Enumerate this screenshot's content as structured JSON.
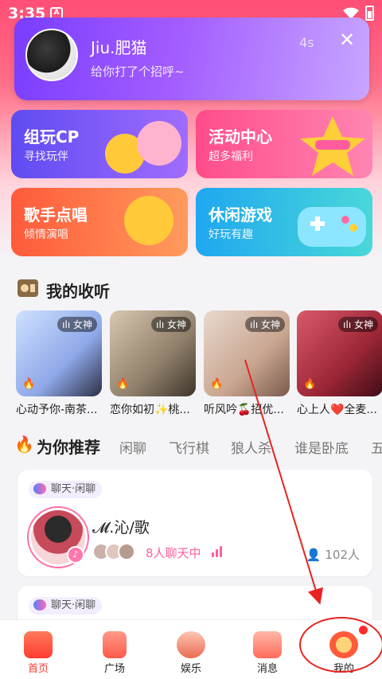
{
  "status_bar": {
    "time": "3:35",
    "app_icon": "A"
  },
  "notification": {
    "sender": "Jiu.肥猫",
    "message": "给你打了个招呼~",
    "time": "4s",
    "close_icon": "close-icon"
  },
  "tiles": [
    {
      "title": "组玩CP",
      "subtitle": "寻找玩伴"
    },
    {
      "title": "活动中心",
      "subtitle": "超多福利"
    },
    {
      "title": "歌手点唱",
      "subtitle": "倾情演唱"
    },
    {
      "title": "休闲游戏",
      "subtitle": "好玩有趣"
    }
  ],
  "listening": {
    "title": "我的收听",
    "items": [
      {
        "badge": "女神",
        "title": "心动予你-南茶..."
      },
      {
        "badge": "女神",
        "title": "恋你如初✨桃..."
      },
      {
        "badge": "女神",
        "title": "听风吟🍒招优..."
      },
      {
        "badge": "女神",
        "title": "心上人❤️全麦..."
      }
    ]
  },
  "recommend": {
    "title": "为你推荐",
    "tabs": [
      "闲聊",
      "飞行棋",
      "狼人杀",
      "谁是卧底",
      "五"
    ]
  },
  "rooms": [
    {
      "tag": "聊天·闲聊",
      "title": "𝓜.沁/歌",
      "chatting": "8人聊天中",
      "count": "102人"
    },
    {
      "tag": "聊天·闲聊"
    }
  ],
  "bottom_nav": [
    {
      "label": "首页",
      "active": true
    },
    {
      "label": "广场"
    },
    {
      "label": "娱乐"
    },
    {
      "label": "消息"
    },
    {
      "label": "我的"
    }
  ],
  "nav_labels": {
    "home": "首页",
    "square": "广场",
    "fun": "娱乐",
    "messages": "消息",
    "me": "我的"
  },
  "colors": {
    "accent": "#ff4f77",
    "nav_active": "#ff3b30",
    "pink": "#ff5fa0"
  }
}
